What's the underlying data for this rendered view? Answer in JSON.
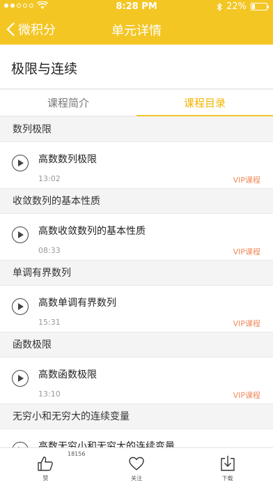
{
  "status": {
    "time": "8:28 PM",
    "battery": "22%",
    "battery_level": 0.22
  },
  "nav": {
    "back_label": "微积分",
    "title": "单元详情"
  },
  "unit": {
    "title": "极限与连续"
  },
  "tabs": [
    {
      "label": "课程简介",
      "active": false
    },
    {
      "label": "课程目录",
      "active": true
    }
  ],
  "sections": [
    {
      "title": "数列极限",
      "lesson": {
        "title": "高数数列极限",
        "duration": "13:02",
        "badge": "VIP课程"
      }
    },
    {
      "title": "收敛数列的基本性质",
      "lesson": {
        "title": "高数收敛数列的基本性质",
        "duration": "08:33",
        "badge": "VIP课程"
      }
    },
    {
      "title": "单调有界数列",
      "lesson": {
        "title": "高数单调有界数列",
        "duration": "15:31",
        "badge": "VIP课程"
      }
    },
    {
      "title": "函数极限",
      "lesson": {
        "title": "高数函数极限",
        "duration": "13:10",
        "badge": "VIP课程"
      }
    },
    {
      "title": "无穷小和无穷大的连续变量",
      "lesson": {
        "title": "高数无穷小和无穷大的连续变量",
        "duration": "",
        "badge": ""
      }
    }
  ],
  "bottom": {
    "like_label": "赞",
    "like_count": "18156",
    "follow_label": "关注",
    "download_label": "下载"
  },
  "colors": {
    "accent": "#f4c624",
    "vip": "#f08a5d"
  },
  "icons": [
    "back-chevron-icon",
    "wifi-icon",
    "bluetooth-icon",
    "battery-icon",
    "play-icon",
    "thumbs-up-icon",
    "heart-icon",
    "download-icon"
  ]
}
